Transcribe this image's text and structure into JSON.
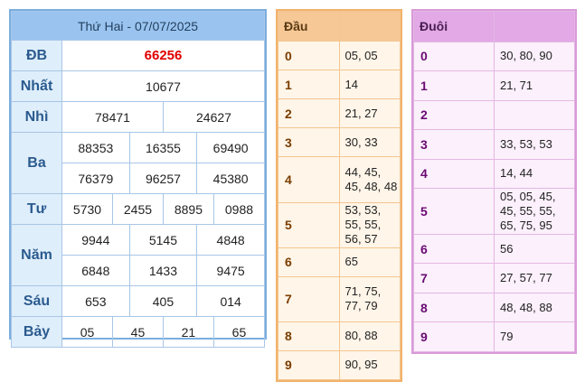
{
  "results": {
    "title": "Thứ Hai - 07/07/2025",
    "rows": [
      {
        "label": "ĐB",
        "numbers": [
          "66256"
        ]
      },
      {
        "label": "Nhất",
        "numbers": [
          "10677"
        ]
      },
      {
        "label": "Nhì",
        "numbers": [
          "78471",
          "24627"
        ]
      },
      {
        "label": "Ba",
        "numbers": [
          "88353",
          "16355",
          "69490",
          "76379",
          "96257",
          "45380"
        ]
      },
      {
        "label": "Tư",
        "numbers": [
          "5730",
          "2455",
          "8895",
          "0988"
        ]
      },
      {
        "label": "Năm",
        "numbers": [
          "9944",
          "5145",
          "4848",
          "6848",
          "1433",
          "9475"
        ]
      },
      {
        "label": "Sáu",
        "numbers": [
          "653",
          "405",
          "014"
        ]
      },
      {
        "label": "Bảy",
        "numbers": [
          "05",
          "45",
          "21",
          "65"
        ]
      }
    ],
    "special_color": "#e00000"
  },
  "dau": {
    "header": "Đầu",
    "header_value": "",
    "rows": [
      {
        "digit": "0",
        "values": "05, 05"
      },
      {
        "digit": "1",
        "values": "14"
      },
      {
        "digit": "2",
        "values": "21, 27"
      },
      {
        "digit": "3",
        "values": "30, 33"
      },
      {
        "digit": "4",
        "values": "44, 45, 45, 48, 48"
      },
      {
        "digit": "5",
        "values": "53, 53, 55, 55, 56, 57"
      },
      {
        "digit": "6",
        "values": "65"
      },
      {
        "digit": "7",
        "values": "71, 75, 77, 79"
      },
      {
        "digit": "8",
        "values": "80, 88"
      },
      {
        "digit": "9",
        "values": "90, 95"
      }
    ]
  },
  "duoi": {
    "header": "Đuôi",
    "header_value": "",
    "rows": [
      {
        "digit": "0",
        "values": "30, 80, 90"
      },
      {
        "digit": "1",
        "values": "21, 71"
      },
      {
        "digit": "2",
        "values": ""
      },
      {
        "digit": "3",
        "values": "33, 53, 53"
      },
      {
        "digit": "4",
        "values": "14, 44"
      },
      {
        "digit": "5",
        "values": "05, 05, 45, 45, 55, 55, 65, 75, 95"
      },
      {
        "digit": "6",
        "values": "56"
      },
      {
        "digit": "7",
        "values": "27, 57, 77"
      },
      {
        "digit": "8",
        "values": "48, 48, 88"
      },
      {
        "digit": "9",
        "values": "79"
      }
    ]
  }
}
